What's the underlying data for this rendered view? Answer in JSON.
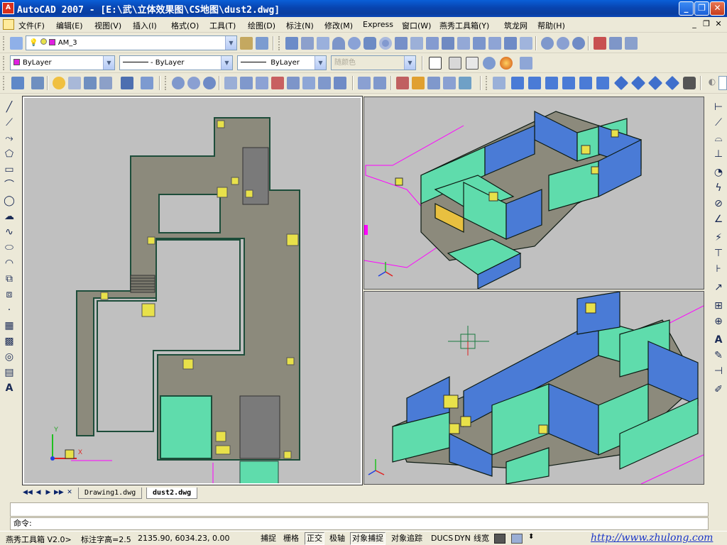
{
  "window": {
    "app_icon_text": "A",
    "title": "AutoCAD 2007 - [E:\\武\\立体效果图\\CS地图\\dust2.dwg]",
    "minimize": "_",
    "maximize": "❐",
    "close": "✕"
  },
  "menu": {
    "items": [
      "文件(F)",
      "编辑(E)",
      "视图(V)",
      "插入(I)",
      "格式(O)",
      "工具(T)",
      "绘图(D)",
      "标注(N)",
      "修改(M)",
      "Express",
      "窗口(W)",
      "燕秀工具箱(Y)",
      "筑龙网",
      "帮助(H)"
    ],
    "mdi_minimize": "_",
    "mdi_restore": "❐",
    "mdi_close": "✕"
  },
  "toolbar": {
    "layer_value": "AM_3",
    "color_value": "ByLayer",
    "linetype_value": "ByLayer",
    "lineweight_value": "ByLayer",
    "plotstyle_value": "随颜色",
    "dropdown_glyph": "▼"
  },
  "tabs": {
    "items": [
      "Drawing1.dwg",
      "dust2.dwg"
    ],
    "active_index": 1,
    "close_glyph": "✕",
    "nav": [
      "◀◀",
      "◀",
      "▶",
      "▶▶"
    ]
  },
  "command": {
    "history": "",
    "prompt": "命令:"
  },
  "status": {
    "plugin_text": "燕秀工具箱 V2.0>",
    "dim_text_height": "标注字高=2.5",
    "coordinates": "2135.90,  6034.23,  0.00",
    "toggles": [
      {
        "label": "捕捉",
        "on": false
      },
      {
        "label": "栅格",
        "on": false
      },
      {
        "label": "正交",
        "on": true
      },
      {
        "label": "极轴",
        "on": false
      },
      {
        "label": "对象捕捉",
        "on": true
      },
      {
        "label": "对象追踪",
        "on": false
      },
      {
        "label": "DUCS",
        "on": false
      },
      {
        "label": "DYN",
        "on": false
      },
      {
        "label": "线宽",
        "on": false
      }
    ],
    "url": "http://www.zhulong.com"
  },
  "colors": {
    "viewport_bg": "#c0c0c0",
    "floor_fill": "#8c8a7c",
    "wall_cyan": "#5fdcac",
    "wall_blue": "#4a7bd6",
    "object_yellow": "#e8e14a",
    "magenta_line": "#ff00ff"
  }
}
